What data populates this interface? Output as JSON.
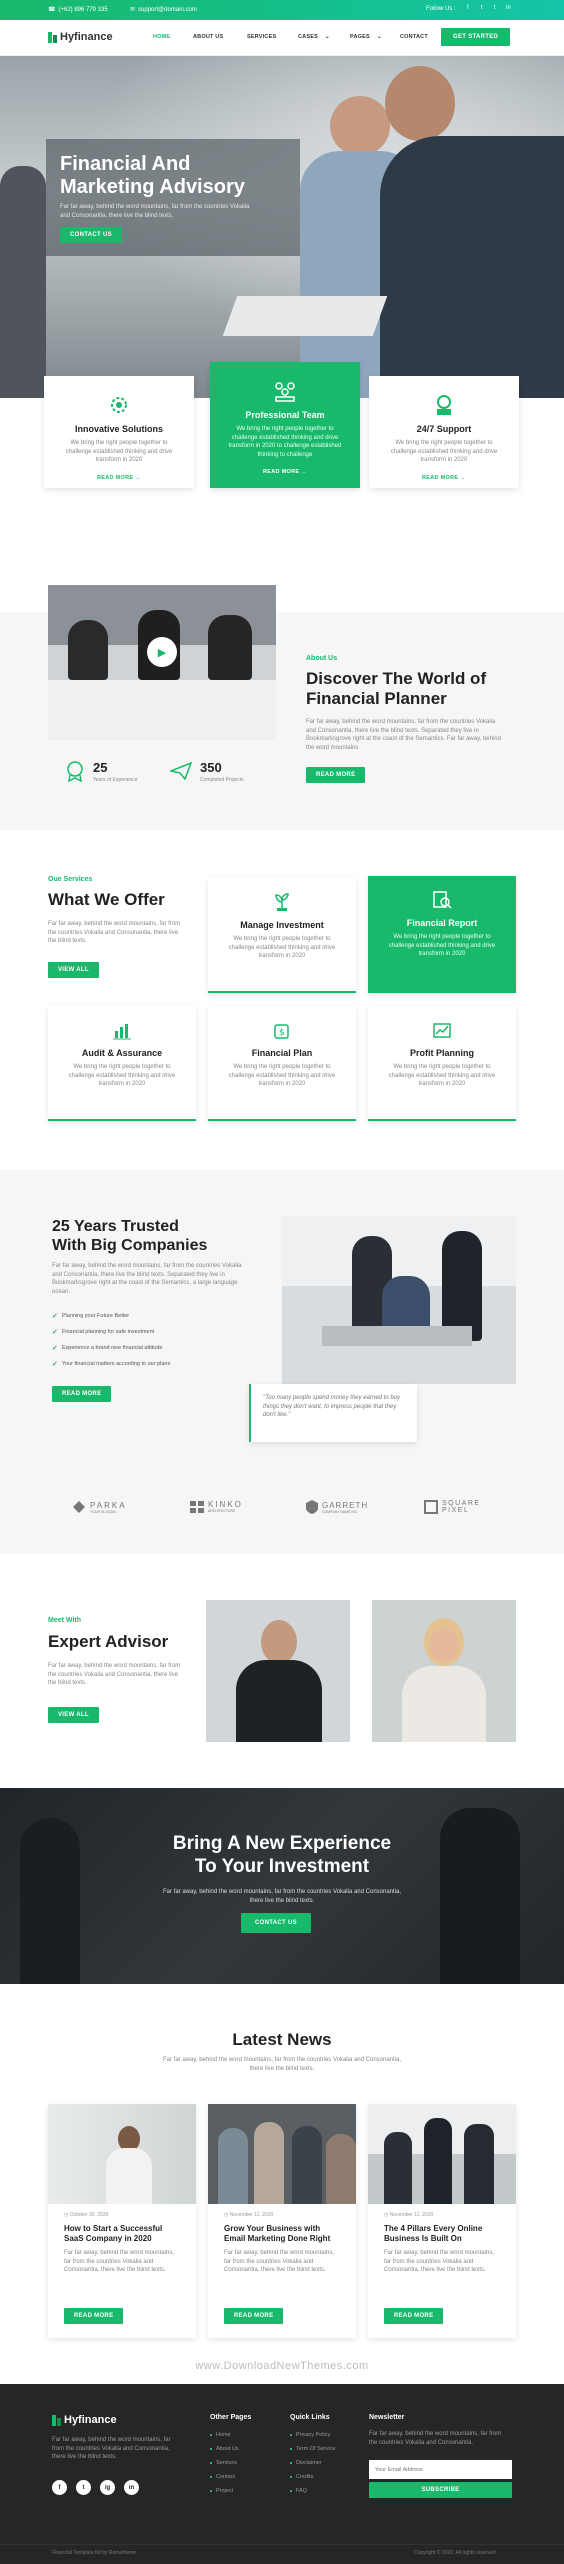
{
  "topbar": {
    "phone": "(+62) 896 779 335",
    "email": "support@domain.com",
    "follow_label": "Follow Us :",
    "social": [
      "f",
      "t",
      "t",
      "in"
    ]
  },
  "brand": {
    "name": "Hyfinance"
  },
  "nav": {
    "items": [
      "HOME",
      "ABOUT US",
      "SERVICES",
      "CASES",
      "PAGES",
      "CONTACT"
    ],
    "cta": "GET STARTED"
  },
  "hero": {
    "title_line1": "Financial And",
    "title_line2": "Marketing Advisory",
    "text": "Far far away, behind the word mountains, far from the countries Vokalia and Consonantia, there live the blind texts.",
    "button": "CONTACT US"
  },
  "features": [
    {
      "title": "Innovative Solutions",
      "text": "We bring the right people together to challenge established thinking and drive transform in 2020",
      "link": "READ MORE →"
    },
    {
      "title": "Professional Team",
      "text": "We bring the right people together to challenge established thinking and drive transform in 2020 to challenge established thinking to challenge",
      "link": "READ MORE →"
    },
    {
      "title": "24/7 Support",
      "text": "We bring the right people together to challenge established thinking and drive transform in 2020",
      "link": "READ MORE →"
    }
  ],
  "about": {
    "eyebrow": "About Us",
    "title_line1": "Discover The World of",
    "title_line2": "Financial Planner",
    "text": "Far far away, behind the word mountains, far from the countries Vokalia and Consonantia, there live the blind texts. Separated they live in Bookmarksgrove right at the coast of the Semantics. Far far away, behind the word mountains",
    "button": "READ MORE",
    "stat1_value": "25",
    "stat1_label": "Years of Experience",
    "stat2_value": "350",
    "stat2_label": "Completed Projects"
  },
  "services": {
    "eyebrow": "Oue Services",
    "title": "What We Offer",
    "text": "Far far away, behind the word mountains, far from the countries Vokalia and Consonantia, there live the blind texts.",
    "button": "VIEW ALL",
    "items": [
      {
        "title": "Manage Investment",
        "text": "We bring the right people together to challenge established thinking and drive transform in 2020"
      },
      {
        "title": "Financial Report",
        "text": "We bring the right people together to challenge established thinking and drive transform in 2020"
      },
      {
        "title": "Audit & Assurance",
        "text": "We bring the right people together to challenge established thinking and drive transform in 2020"
      },
      {
        "title": "Financial Plan",
        "text": "We bring the right people together to challenge established thinking and drive transform in 2020"
      },
      {
        "title": "Profit Planning",
        "text": "We bring the right people together to challenge established thinking and drive transform in 2020"
      }
    ]
  },
  "trusted": {
    "title_line1": "25 Years Trusted",
    "title_line2": "With Big Companies",
    "text": "Far far away, behind the word mountains, far from the countries Vokalia and Consonantia, there live the blind texts. Separated they live in Bookmarksgrove right at the coast of the Semantics, a large language ocean.",
    "checks": [
      "Planning your Future Better",
      "Financial planning for safe investment",
      "Experience a brand new financial attitude",
      "Your financial matters according to our plans"
    ],
    "button": "READ MORE",
    "quote": "\"Too many people spend money they earned to buy things they don't want, to impress people that they don't like.\""
  },
  "partners": [
    {
      "name": "PARKA",
      "tag": "YOUR SLOGAN"
    },
    {
      "name": "KINKO",
      "tag": "ARCHITECTURE"
    },
    {
      "name": "GARRETH",
      "tag": "COMPANY NAME INC"
    },
    {
      "name": "SQUARE PIXEL",
      "tag": ""
    }
  ],
  "advisor": {
    "eyebrow": "Meet With",
    "title": "Expert Advisor",
    "text": "Far far away, behind the word mountains, far from the countries Vokalia and Consonantia, there live the blind texts.",
    "button": "VIEW ALL"
  },
  "banner": {
    "title_line1": "Bring A New Experience",
    "title_line2": "To Your Investment",
    "text": "Far far away, behind the word mountains, far from the countries Vokalia and Consonantia, there live the blind texts.",
    "button": "CONTACT US"
  },
  "news": {
    "title": "Latest News",
    "text": "Far far away, behind the word mountains, far from the countries Vokalia and Consonantia, there live the blind texts.",
    "items": [
      {
        "date": "October 30, 2020",
        "title": "How to Start a Successful SaaS Company in 2020",
        "text": "Far far away, behind the word mountains, far from the countries Vokalia and Consonantia, there live the blind texts.",
        "button": "READ MORE"
      },
      {
        "date": "November 11, 2020",
        "title": "Grow Your Business with Email Marketing Done Right",
        "text": "Far far away, behind the word mountains, far from the countries Vokalia and Consonantia, there live the blind texts.",
        "button": "READ MORE"
      },
      {
        "date": "November 11, 2020",
        "title": "The 4 Pillars Every Online Business Is Built On",
        "text": "Far far away, behind the word mountains, far from the countries Vokalia and Consonantia, there live the blind texts.",
        "button": "READ MORE"
      }
    ]
  },
  "watermark": "www.DownloadNewThemes.com",
  "footer": {
    "text": "Far far away, behind the word mountains, far from the countries Vokalia and Consonantia, there live the blind texts.",
    "col1_title": "Other Pages",
    "col1": [
      "Home",
      "About Us",
      "Services",
      "Contact",
      "Project"
    ],
    "col2_title": "Quick Links",
    "col2": [
      "Privacy Policy",
      "Term Of Service",
      "Disclaimer",
      "Credits",
      "FAQ"
    ],
    "col3_title": "Newsletter",
    "col3_text": "Far far away, behind the word mountains, far from the countries Vokalia and Consonantia.",
    "email_placeholder": "Your Email Address",
    "subscribe": "SUBSCRIBE",
    "social": [
      "f",
      "t",
      "ig",
      "in"
    ],
    "copyright_left": "Financial Template Kit by Rometheme",
    "copyright_right": "Copyright © 2020. All rights reserved"
  },
  "colors": {
    "accent": "#18b96b",
    "dark": "#262626"
  }
}
